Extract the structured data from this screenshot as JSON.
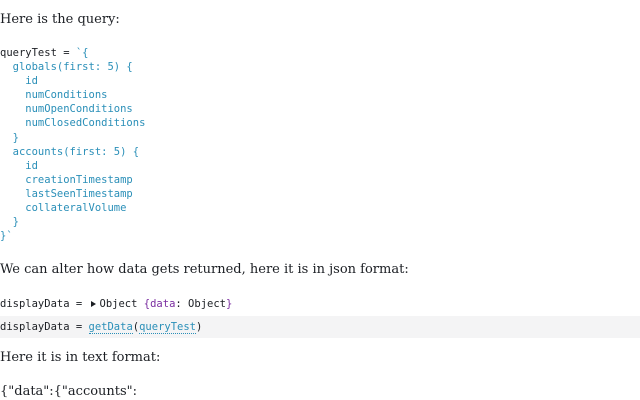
{
  "intro_text": "Here is the query:",
  "query_lines": [
    {
      "lead": "queryTest = ",
      "code": "`{"
    },
    {
      "lead": "",
      "code": "  globals(first: 5) {"
    },
    {
      "lead": "",
      "code": "    id"
    },
    {
      "lead": "",
      "code": "    numConditions"
    },
    {
      "lead": "",
      "code": "    numOpenConditions"
    },
    {
      "lead": "",
      "code": "    numClosedConditions"
    },
    {
      "lead": "",
      "code": "  }"
    },
    {
      "lead": "",
      "code": "  accounts(first: 5) {"
    },
    {
      "lead": "",
      "code": "    id"
    },
    {
      "lead": "",
      "code": "    creationTimestamp"
    },
    {
      "lead": "",
      "code": "    lastSeenTimestamp"
    },
    {
      "lead": "",
      "code": "    collateralVolume"
    },
    {
      "lead": "",
      "code": "  }"
    },
    {
      "lead": "",
      "code": "}`"
    }
  ],
  "json_text": "We can alter how data gets returned, here it is in json format:",
  "output_cell": {
    "prefix": "displayData = ",
    "object_label": "Object",
    "open_brace": "{",
    "key": "data",
    "value": ": Object",
    "close_brace": "}"
  },
  "input_cell": {
    "prefix": "displayData = ",
    "function": "getData",
    "open_paren": "(",
    "argument": "queryTest",
    "close_paren": ")"
  },
  "text_format_label": "Here it is in text format:",
  "text_output_start": "{\"data\":{\"accounts\":"
}
